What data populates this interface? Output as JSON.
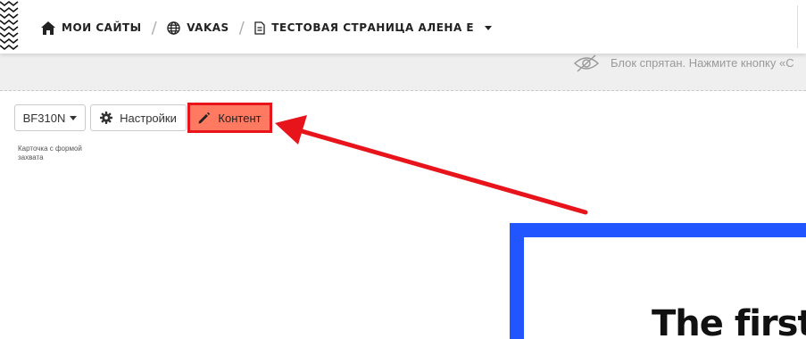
{
  "header": {
    "breadcrumb": {
      "home_label": "МОИ САЙТЫ",
      "site_label": "VAKAS",
      "page_label": "ТЕСТОВАЯ СТРАНИЦА АЛЕНА Е"
    }
  },
  "hidden_block": {
    "note": "Блок спрятан. Нажмите кнопку «С"
  },
  "toolbar": {
    "block_code": "BF310N",
    "settings_label": "Настройки",
    "content_label": "Контент",
    "block_caption": "Карточка с формой захвата"
  },
  "preview": {
    "title": "The first"
  },
  "colors": {
    "highlight_border": "#e8141c",
    "highlight_fill": "#ff7a60",
    "arrow": "#e8141c",
    "preview_frame": "#2155ff"
  },
  "icons": {
    "home": "home-icon",
    "globe": "globe-icon",
    "page": "document-icon",
    "hidden": "eye-slash-icon",
    "settings": "gear-icon",
    "content": "pencil-icon"
  }
}
